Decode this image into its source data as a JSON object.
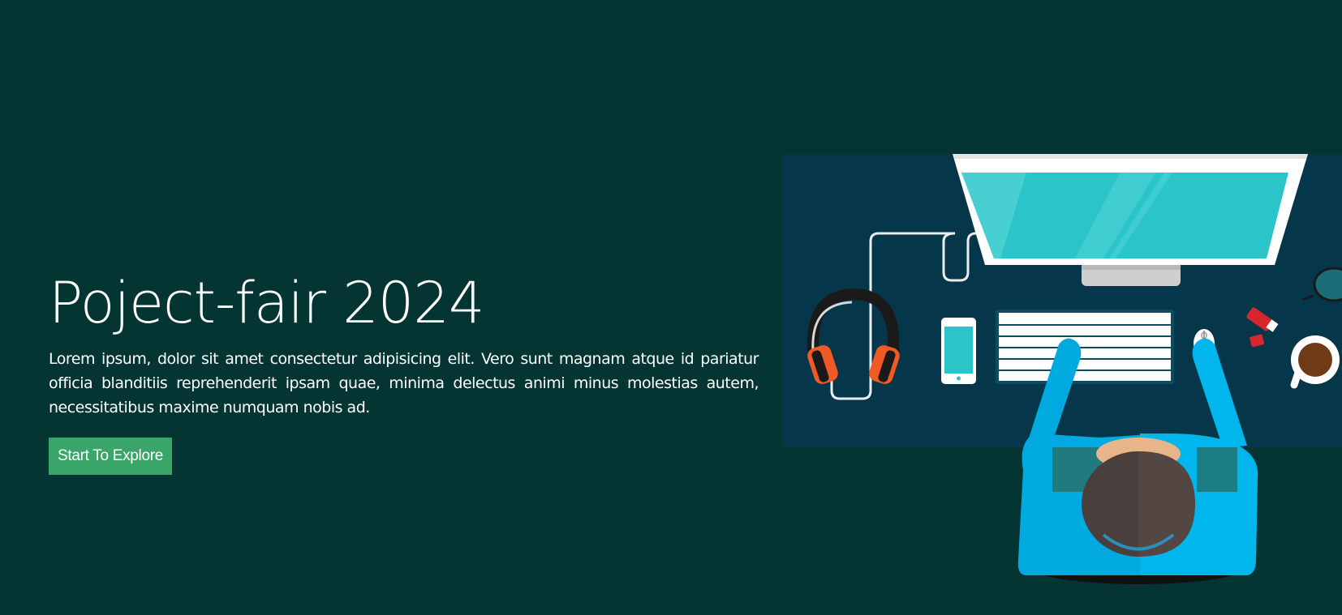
{
  "hero": {
    "title": "Poject-fair 2024",
    "description": "Lorem ipsum, dolor sit amet consectetur adipisicing elit. Vero sunt magnam atque id pariatur officia blanditiis reprehenderit ipsam quae, minima delectus animi minus molestias autem, necessitatibus maxime numquam nobis ad.",
    "cta_label": "Start To Explore"
  },
  "illustration": {
    "icon": "workspace-desk-illustration",
    "items": [
      "monitor",
      "headphones",
      "smartphone",
      "keyboard",
      "mouse",
      "usb-drive",
      "coffee-cup",
      "glasses",
      "person"
    ]
  },
  "colors": {
    "background": "#053533",
    "desk": "#06364a",
    "button": "#3aa569",
    "screen": "#2bc5c9",
    "shirt": "#00a9e0",
    "hair": "#4a3f3c",
    "headphones": "#f15a24"
  }
}
